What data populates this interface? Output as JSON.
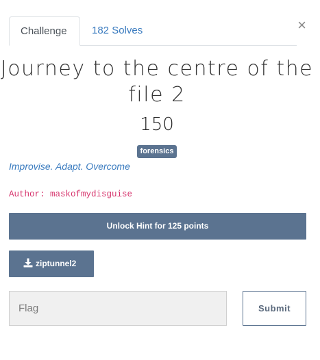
{
  "modal": {
    "close_glyph": "×"
  },
  "tabs": [
    {
      "label": "Challenge",
      "active": true
    },
    {
      "label": "182 Solves",
      "active": false
    }
  ],
  "challenge": {
    "title": "Journey to the centre of the file 2",
    "points": "150",
    "tag": "forensics",
    "description": "Improvise. Adapt. Overcome",
    "author": "Author: maskofmydisguise"
  },
  "buttons": {
    "hint_label": "Unlock Hint for 125 points",
    "file_label": "ziptunnel2",
    "file_icon": "download-icon",
    "submit_label": "Submit"
  },
  "flag_input": {
    "placeholder": "Flag",
    "value": ""
  },
  "colors": {
    "primary": "#5b7390",
    "link": "#3a7bbf",
    "author": "#d6336c"
  }
}
